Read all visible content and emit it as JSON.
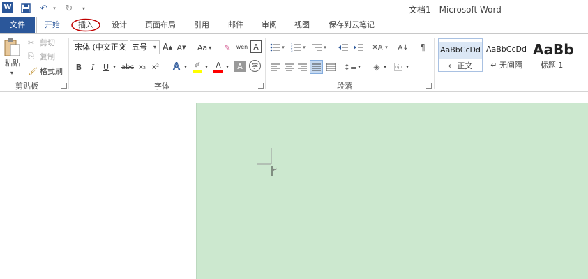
{
  "window": {
    "title": "文档1 - Microsoft Word"
  },
  "tabs": {
    "file": "文件",
    "home": "开始",
    "insert": "插入",
    "design": "设计",
    "layout": "页面布局",
    "references": "引用",
    "mailings": "邮件",
    "review": "审阅",
    "view": "视图",
    "save_to_cloud": "保存到云笔记"
  },
  "clipboard": {
    "paste": "粘贴",
    "cut": "剪切",
    "copy": "复制",
    "format_painter": "格式刷",
    "group_label": "剪贴板"
  },
  "font": {
    "font_name": "宋体 (中文正文",
    "font_size": "五号",
    "change_case_label": "Aa",
    "phonetic_label": "wén",
    "bold": "B",
    "italic": "I",
    "underline": "U",
    "strikethrough": "abc",
    "subscript": "x₂",
    "superscript": "x²",
    "text_effects": "A",
    "font_color_letter": "A",
    "char_shading": "A",
    "group_label": "字体"
  },
  "paragraph": {
    "group_label": "段落"
  },
  "styles": {
    "items": [
      {
        "preview": "AaBbCcDd",
        "name": "↵ 正文"
      },
      {
        "preview": "AaBbCcDd",
        "name": "↵ 无间隔"
      },
      {
        "preview": "AaBb",
        "name": "标题 1"
      }
    ]
  },
  "colors": {
    "accent": "#2b579a",
    "page_background": "#cce8cf",
    "highlight": "#ffff00",
    "font_color": "#ff0000",
    "annotation": "#c00000"
  }
}
